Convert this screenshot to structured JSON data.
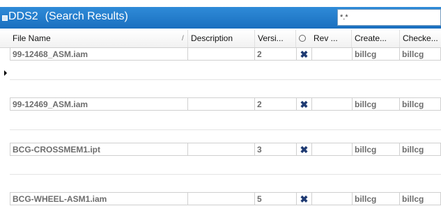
{
  "window": {
    "title": "DDS2",
    "subtitle": "(Search Results)"
  },
  "search": {
    "value": "*.*"
  },
  "columns": [
    {
      "key": "file_name",
      "label": "File Name"
    },
    {
      "key": "description",
      "label": "Description"
    },
    {
      "key": "version",
      "label": "Versi..."
    },
    {
      "key": "rev",
      "label": "Rev ..."
    },
    {
      "key": "created_by",
      "label": "Create..."
    },
    {
      "key": "checked_by",
      "label": "Checke..."
    }
  ],
  "header": {
    "sort_indicator": "/"
  },
  "rows": [
    {
      "file_name": "99-12468_ASM.iam",
      "description": "",
      "version": "2",
      "checked_out": "✖",
      "rev": "",
      "created_by": "billcg",
      "checked_by": "billcg"
    },
    {
      "file_name": "99-12469_ASM.iam",
      "description": "",
      "version": "2",
      "checked_out": "✖",
      "rev": "",
      "created_by": "billcg",
      "checked_by": "billcg"
    },
    {
      "file_name": "BCG-CROSSMEM1.ipt",
      "description": "",
      "version": "3",
      "checked_out": "✖",
      "rev": "",
      "created_by": "billcg",
      "checked_by": "billcg"
    },
    {
      "file_name": "BCG-WHEEL-ASM1.iam",
      "description": "",
      "version": "5",
      "checked_out": "✖",
      "rev": "",
      "created_by": "billcg",
      "checked_by": "billcg"
    }
  ],
  "colors": {
    "titlebar": "#1f78c8",
    "check_mark": "#1e3a72",
    "cell_text": "#6d6d6d"
  }
}
